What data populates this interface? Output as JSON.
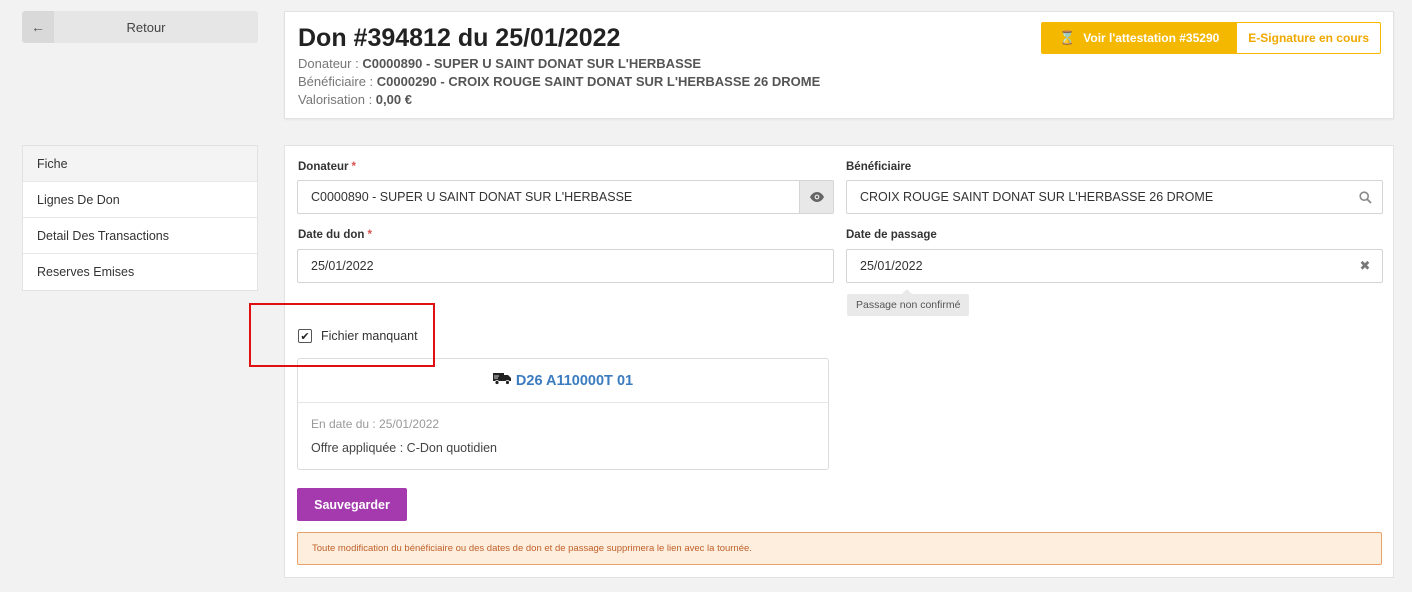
{
  "back": {
    "label": "Retour",
    "icon": "arrow-left-icon"
  },
  "header": {
    "title": "Don #394812 du 25/01/2022",
    "donateur_label": "Donateur : ",
    "donateur_value": "C0000890 - SUPER U SAINT DONAT SUR L'HERBASSE",
    "beneficiaire_label": "Bénéficiaire : ",
    "beneficiaire_value": "C0000290 - CROIX ROUGE SAINT DONAT SUR L'HERBASSE 26 DROME",
    "valorisation_label": "Valorisation : ",
    "valorisation_value": "0,00 €",
    "attestation_button": "Voir l'attestation #35290",
    "signature_button": "E-Signature en cours"
  },
  "side_menu": {
    "items": [
      {
        "label": "Fiche",
        "active": true
      },
      {
        "label": "Lignes De Don"
      },
      {
        "label": "Detail Des Transactions"
      },
      {
        "label": "Reserves Emises"
      }
    ]
  },
  "form": {
    "donateur": {
      "label": "Donateur",
      "value": "C0000890 - SUPER U SAINT DONAT SUR L'HERBASSE",
      "required": "*"
    },
    "beneficiaire": {
      "label": "Bénéficiaire",
      "value": "CROIX ROUGE SAINT DONAT SUR L'HERBASSE 26 DROME"
    },
    "date_don": {
      "label": "Date du don",
      "value": "25/01/2022",
      "required": "*"
    },
    "date_passage": {
      "label": "Date de passage",
      "value": "25/01/2022",
      "tooltip": "Passage non confirmé"
    },
    "fichier_manquant": {
      "label": "Fichier manquant",
      "checked": true,
      "check_glyph": "✔"
    },
    "route": {
      "code": "D26 A110000T 01",
      "date_line": "En date du : 25/01/2022",
      "offre_line": "Offre appliquée : C-Don quotidien"
    },
    "save_label": "Sauvegarder",
    "alert_text": "Toute modification du bénéficiaire ou des dates de don et de passage supprimera le lien avec la tournée."
  },
  "colors": {
    "accent_yellow": "#f5b800",
    "save_purple": "#a43aae",
    "link_blue": "#3b7bbf",
    "highlight_red": "#e01010",
    "alert_bg": "#fdeede"
  }
}
